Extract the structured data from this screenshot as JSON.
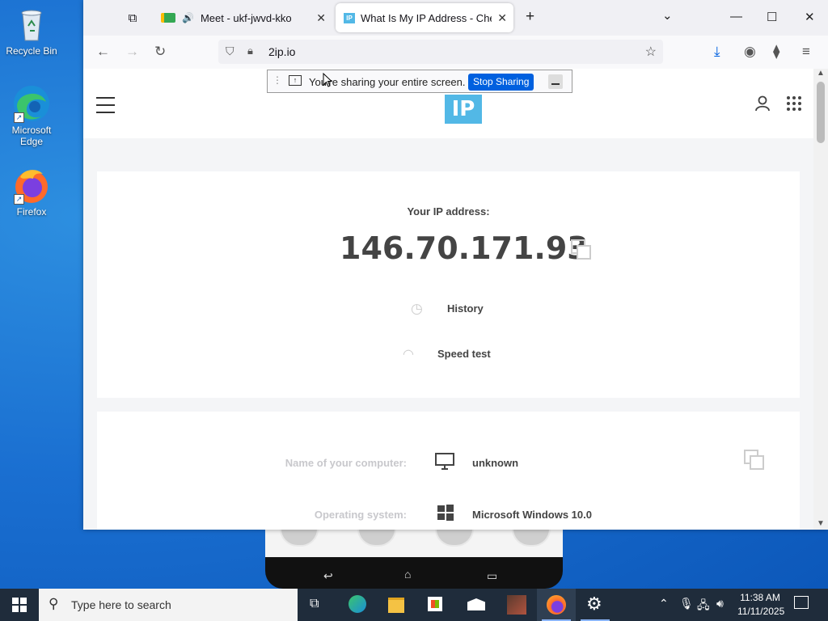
{
  "desktop": {
    "icons": [
      {
        "label": "Recycle Bin",
        "icon": "recycle-bin-icon"
      },
      {
        "label": "Microsoft Edge",
        "icon": "edge-icon"
      },
      {
        "label": "Firefox",
        "icon": "firefox-icon"
      }
    ]
  },
  "browser": {
    "tabs": [
      {
        "title": "Meet - ukf-jwvd-kko",
        "icon": "google-meet-icon",
        "audio": true
      },
      {
        "title": "What Is My IP Address - Check",
        "icon": "2ip-favicon",
        "active": true
      }
    ],
    "url": "2ip.io"
  },
  "share_banner": {
    "message": "You're sharing your entire screen.",
    "stop_label": "Stop Sharing"
  },
  "page": {
    "logo_text": "IP",
    "ip_label": "Your IP address:",
    "ip_value": "146.70.171.93",
    "links": [
      {
        "label": "History",
        "icon": "history-icon"
      },
      {
        "label": "Speed test",
        "icon": "speedometer-icon"
      }
    ],
    "info_rows": [
      {
        "label": "Name of your computer:",
        "value": "unknown",
        "icon": "monitor-icon"
      },
      {
        "label": "Operating system:",
        "value": "Microsoft Windows 10.0",
        "icon": "windows-logo-icon"
      }
    ]
  },
  "taskbar": {
    "search_placeholder": "Type here to search",
    "time": "11:38 AM",
    "date": "11/11/2025",
    "apps": [
      "task-view-icon",
      "edge-icon",
      "file-explorer-icon",
      "store-icon",
      "mail-icon",
      "photo-app-icon",
      "firefox-icon",
      "settings-icon"
    ]
  },
  "colors": {
    "accent": "#0060df",
    "logo": "#52b8e6",
    "taskbar": "#1f2c3b"
  }
}
